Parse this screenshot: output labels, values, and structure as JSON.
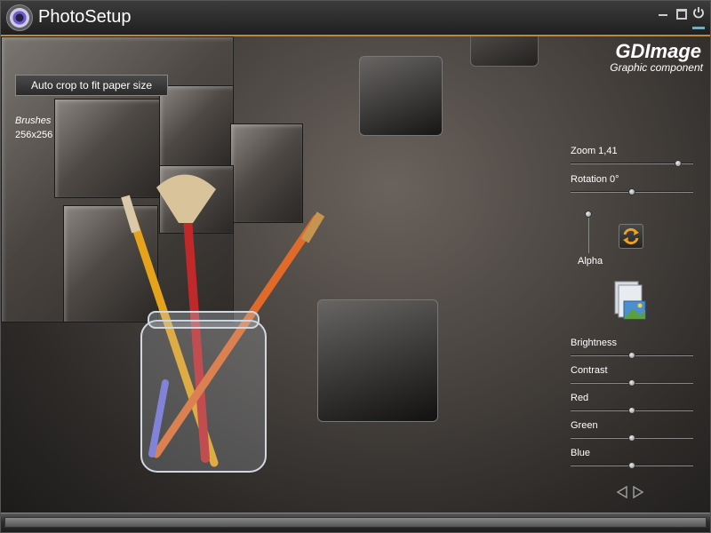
{
  "window": {
    "title": "PhotoSetup",
    "controls": {
      "minimize_icon": "minimize-icon",
      "maximize_icon": "maximize-icon",
      "close_icon": "power-icon"
    },
    "accent_color": "#b98a3e"
  },
  "toolbar": {
    "crop_label": "Auto crop to fit paper size"
  },
  "image_info": {
    "name": "Brushes",
    "size": "256x256"
  },
  "brand": {
    "title": "GDImage",
    "subtitle": "Graphic component"
  },
  "controls": {
    "zoom": {
      "label": "Zoom 1,41",
      "value_fraction": 0.9
    },
    "rotation": {
      "label": "Rotation 0°",
      "value_fraction": 0.5
    },
    "alpha": {
      "label": "Alpha",
      "value_fraction": 1.0
    },
    "brightness": {
      "label": "Brightness",
      "value_fraction": 0.5
    },
    "contrast": {
      "label": "Contrast",
      "value_fraction": 0.5
    },
    "red": {
      "label": "Red",
      "value_fraction": 0.5
    },
    "green": {
      "label": "Green",
      "value_fraction": 0.5
    },
    "blue": {
      "label": "Blue",
      "value_fraction": 0.5
    }
  },
  "icons": {
    "refresh": "refresh-icon",
    "image_library": "image-library-icon",
    "prev": "triangle-left-icon",
    "next": "triangle-right-icon"
  }
}
